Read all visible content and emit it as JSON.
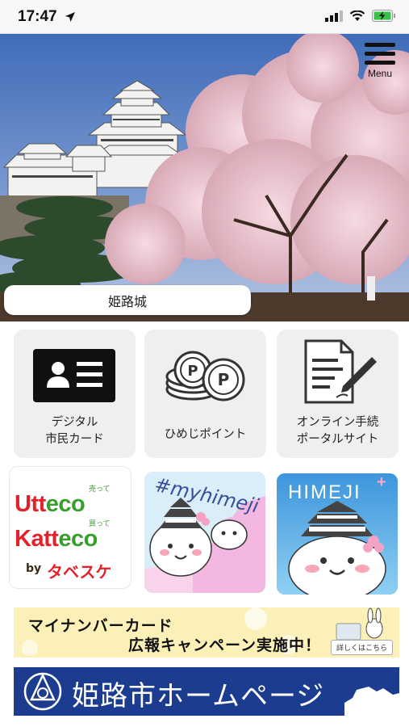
{
  "status_bar": {
    "time": "17:47"
  },
  "header": {
    "menu_label": "Menu"
  },
  "hero": {
    "caption": "姫路城"
  },
  "menu_buttons": [
    {
      "line1": "デジタル",
      "line2": "市民カード"
    },
    {
      "line1": "ひめじポイント",
      "line2": ""
    },
    {
      "line1": "オンライン手続",
      "line2": "ポータルサイト"
    }
  ],
  "app_tiles": {
    "utteco": {
      "word1": "Utt",
      "word1b": "eco",
      "word2": "Katt",
      "word2b": "eco",
      "small1": "売って",
      "small2": "買って",
      "by": "by",
      "brand": "タベスケ"
    },
    "myhimeji": {
      "tag": "#myhimeji"
    },
    "himeji_plus": {
      "title": "HIMEJI",
      "plus": "+"
    }
  },
  "banners": {
    "mynumber": {
      "line1": "マイナンバーカード",
      "line2": "広報キャンペーン実施中！",
      "detail": "詳しくはこちら"
    },
    "homepage": {
      "title": "姫路市ホームページ"
    }
  },
  "colors": {
    "homepage_bg": "#1b3c8f",
    "mynumber_bg": "#fbf1b8",
    "tile_bg": "#efefef"
  }
}
